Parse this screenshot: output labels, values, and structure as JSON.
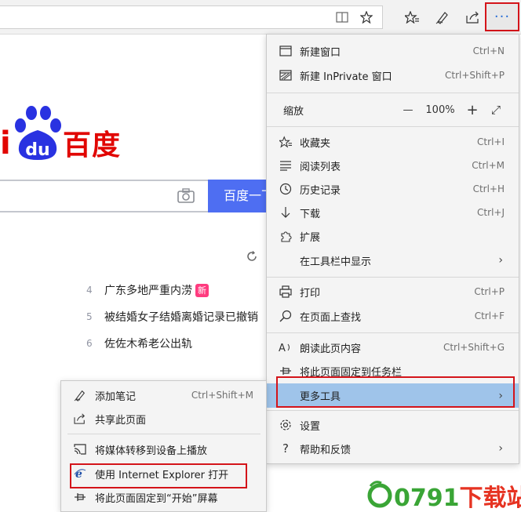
{
  "toolbar": {
    "more_label": "···",
    "icons": [
      "reading-view-icon",
      "favorite-star-icon",
      "favorites-icon",
      "pen-icon",
      "share-icon",
      "more-icon"
    ]
  },
  "page": {
    "logo_i": "i",
    "logo_du": "du",
    "logo_text": "百度",
    "search_button": "百度一下",
    "hot_list": [
      {
        "num": "4",
        "title": "广东多地严重内涝",
        "badge": "新"
      },
      {
        "num": "5",
        "title": "被结婚女子结婚离婚记录已撤销",
        "badge": ""
      },
      {
        "num": "6",
        "title": "佐佐木希老公出轨",
        "badge": ""
      }
    ]
  },
  "menu": {
    "new_window": {
      "label": "新建窗口",
      "shortcut": "Ctrl+N"
    },
    "new_inprivate": {
      "label": "新建 InPrivate 窗口",
      "shortcut": "Ctrl+Shift+P"
    },
    "zoom": {
      "label": "缩放",
      "minus": "—",
      "value": "100%",
      "plus": "+",
      "fullscreen": "⤢"
    },
    "favorites": {
      "label": "收藏夹",
      "shortcut": "Ctrl+I"
    },
    "reading_list": {
      "label": "阅读列表",
      "shortcut": "Ctrl+M"
    },
    "history": {
      "label": "历史记录",
      "shortcut": "Ctrl+H"
    },
    "downloads": {
      "label": "下载",
      "shortcut": "Ctrl+J"
    },
    "extensions": {
      "label": "扩展",
      "shortcut": ""
    },
    "show_in_toolbar": {
      "label": "在工具栏中显示",
      "chevron": "›"
    },
    "print": {
      "label": "打印",
      "shortcut": "Ctrl+P"
    },
    "find": {
      "label": "在页面上查找",
      "shortcut": "Ctrl+F"
    },
    "read_aloud": {
      "label": "朗读此页内容",
      "shortcut": "Ctrl+Shift+G"
    },
    "pin_taskbar": {
      "label": "将此页面固定到任务栏",
      "shortcut": ""
    },
    "more_tools": {
      "label": "更多工具",
      "chevron": "›"
    },
    "settings": {
      "label": "设置",
      "shortcut": ""
    },
    "help": {
      "label": "帮助和反馈",
      "chevron": "›"
    }
  },
  "submenu": {
    "add_notes": {
      "label": "添加笔记",
      "shortcut": "Ctrl+Shift+M"
    },
    "share_page": {
      "label": "共享此页面",
      "shortcut": ""
    },
    "cast_media": {
      "label": "将媒体转移到设备上播放",
      "shortcut": ""
    },
    "open_with_ie": {
      "label": "使用 Internet Explorer 打开",
      "shortcut": ""
    },
    "pin_start": {
      "label": "将此页面固定到“开始”屏幕",
      "shortcut": ""
    }
  },
  "watermark": {
    "digits": "0791",
    "cn": "下载站"
  },
  "colors": {
    "accent_highlight": "#9fc4ea",
    "callout_red": "#d4141a",
    "baidu_red": "#e10602",
    "baidu_blue": "#2932e1",
    "search_blue": "#4e6ef2"
  }
}
